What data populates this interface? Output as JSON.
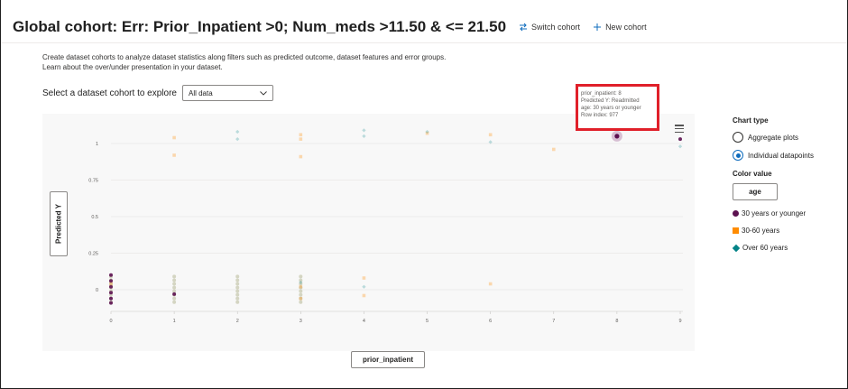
{
  "header": {
    "title": "Global cohort: Err: Prior_Inpatient >0; Num_meds >11.50 & <= 21.50",
    "switch_cohort": "Switch cohort",
    "new_cohort": "New cohort"
  },
  "description": "Create dataset cohorts to analyze dataset statistics along filters such as predicted outcome, dataset features and error groups. Learn about the over/under presentation in your dataset.",
  "cohort_select": {
    "label": "Select a dataset cohort to explore",
    "value": "All data"
  },
  "tooltip": {
    "line1": "prior_inpatient: 8",
    "line2": "Predicted Y: Readmitted",
    "line3": "age: 30 years or younger",
    "line4": "Row index: 977"
  },
  "axes": {
    "y_button": "Predicted Y",
    "x_button": "prior_inpatient"
  },
  "side_panel": {
    "chart_type_label": "Chart type",
    "option_aggregate": "Aggregate plots",
    "option_individual": "Individual datapoints",
    "selected_chart_type": "Individual datapoints",
    "color_value_label": "Color value",
    "color_button": "age",
    "legend": [
      {
        "label": "30 years or younger",
        "color": "#5c1150",
        "shape": "circle"
      },
      {
        "label": "30-60 years",
        "color": "#ff8c00",
        "shape": "square"
      },
      {
        "label": "Over 60 years",
        "color": "#038387",
        "shape": "diamond"
      }
    ]
  },
  "chart_data": {
    "type": "scatter",
    "xlabel": "prior_inpatient",
    "ylabel": "Predicted Y",
    "x_ticks": [
      "0",
      "1",
      "2",
      "3",
      "4",
      "5",
      "6",
      "7",
      "8",
      "9"
    ],
    "y_ticks": [
      "0",
      "0.25",
      "0.5",
      "0.75",
      "1"
    ],
    "xlim": [
      0,
      9
    ],
    "ylim": [
      -0.12,
      1.12
    ],
    "series": [
      {
        "name": "30 years or younger",
        "color": "#5c1150",
        "points": [
          [
            0,
            0.1
          ],
          [
            0,
            0.06
          ],
          [
            0,
            0.02
          ],
          [
            0,
            -0.02
          ],
          [
            0,
            -0.06
          ],
          [
            0,
            -0.09
          ],
          [
            1,
            -0.03
          ],
          [
            8,
            1.05
          ],
          [
            9,
            1.03
          ]
        ]
      },
      {
        "name": "30-60 years",
        "color": "#ff8c00",
        "points": [
          [
            1,
            1.04
          ],
          [
            1,
            0.92
          ],
          [
            3,
            1.06
          ],
          [
            3,
            1.03
          ],
          [
            3,
            0.91
          ],
          [
            4,
            0.08
          ],
          [
            4,
            -0.04
          ],
          [
            3,
            0.02
          ],
          [
            3,
            -0.06
          ],
          [
            5,
            1.07
          ],
          [
            6,
            1.06
          ],
          [
            6,
            0.04
          ],
          [
            7,
            0.96
          ],
          [
            0,
            0.04
          ]
        ]
      },
      {
        "name": "Over 60 years",
        "color": "#038387",
        "points": [
          [
            2,
            1.08
          ],
          [
            2,
            1.03
          ],
          [
            4,
            1.09
          ],
          [
            4,
            1.05
          ],
          [
            5,
            1.08
          ],
          [
            6,
            1.01
          ],
          [
            9,
            0.98
          ],
          [
            4,
            0.02
          ],
          [
            3,
            0.05
          ]
        ]
      }
    ]
  }
}
